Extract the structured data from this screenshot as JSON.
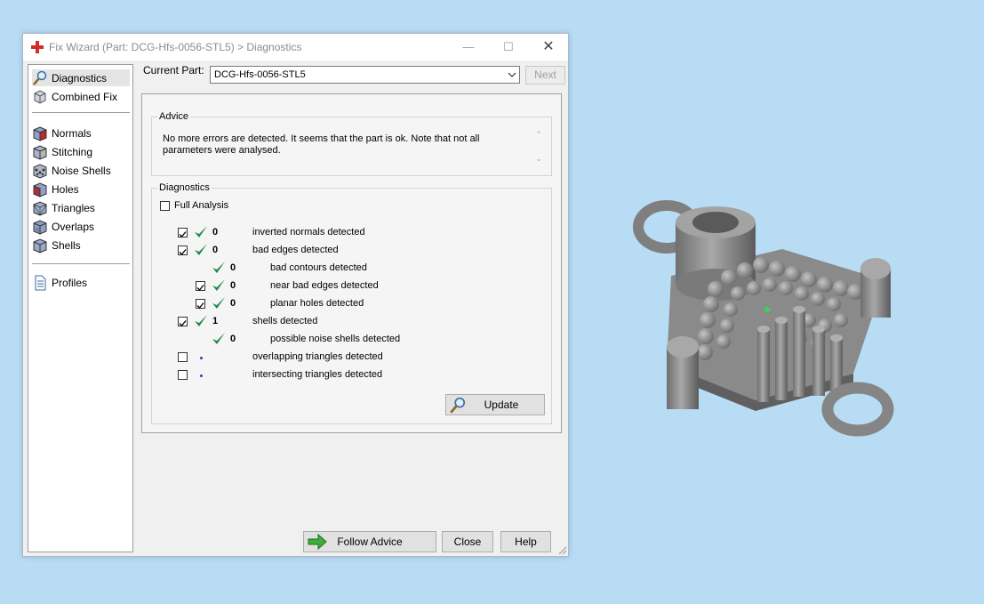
{
  "window": {
    "title": "Fix Wizard (Part: DCG-Hfs-0056-STL5) > Diagnostics",
    "min_glyph": "—",
    "max_glyph": "☐",
    "close_glyph": "✕"
  },
  "sidebar": {
    "items": [
      {
        "label": "Diagnostics",
        "icon": "magnifier-icon",
        "selected": true
      },
      {
        "label": "Combined Fix",
        "icon": "combined-fix-icon"
      },
      {
        "label": "Normals",
        "icon": "normals-cube-icon"
      },
      {
        "label": "Stitching",
        "icon": "stitching-cube-icon"
      },
      {
        "label": "Noise Shells",
        "icon": "noise-shells-icon"
      },
      {
        "label": "Holes",
        "icon": "holes-cube-icon"
      },
      {
        "label": "Triangles",
        "icon": "triangles-cube-icon"
      },
      {
        "label": "Overlaps",
        "icon": "overlaps-cube-icon"
      },
      {
        "label": "Shells",
        "icon": "shells-cube-icon"
      },
      {
        "label": "Profiles",
        "icon": "profiles-document-icon"
      }
    ]
  },
  "part": {
    "label": "Current Part:",
    "value": "DCG-Hfs-0056-STL5",
    "next_label": "Next"
  },
  "advice": {
    "title": "Advice",
    "text": "No more errors are detected. It seems that the part is ok. Note that not all parameters were analysed."
  },
  "diagnostics": {
    "title": "Diagnostics",
    "full_analysis_label": "Full Analysis",
    "full_analysis_checked": false,
    "rows": [
      {
        "checkbox": true,
        "checked": true,
        "status": "ok",
        "count": "0",
        "label": "inverted normals detected",
        "indent": 0
      },
      {
        "checkbox": true,
        "checked": true,
        "status": "ok",
        "count": "0",
        "label": "bad edges detected",
        "indent": 0
      },
      {
        "checkbox": false,
        "checked": false,
        "status": "ok",
        "count": "0",
        "label": "bad contours detected",
        "indent": 1
      },
      {
        "checkbox": true,
        "checked": true,
        "status": "ok",
        "count": "0",
        "label": "near bad edges detected",
        "indent": 1
      },
      {
        "checkbox": true,
        "checked": true,
        "status": "ok",
        "count": "0",
        "label": "planar holes detected",
        "indent": 1
      },
      {
        "checkbox": true,
        "checked": true,
        "status": "ok",
        "count": "1",
        "label": "shells detected",
        "indent": 0
      },
      {
        "checkbox": false,
        "checked": false,
        "status": "ok",
        "count": "0",
        "label": "possible noise shells detected",
        "indent": 1
      },
      {
        "checkbox": true,
        "checked": false,
        "status": "pending",
        "count": "",
        "label": "overlapping triangles detected",
        "indent": 0
      },
      {
        "checkbox": true,
        "checked": false,
        "status": "pending",
        "count": "",
        "label": "intersecting triangles detected",
        "indent": 0
      }
    ],
    "update_label": "Update"
  },
  "buttons": {
    "follow_advice": "Follow Advice",
    "close": "Close",
    "help": "Help"
  },
  "colors": {
    "desktop": "#b9dcf5",
    "check_green": "#1f8a4a",
    "logo_red": "#d42a2a",
    "model_gray": "#8a8a8a"
  }
}
